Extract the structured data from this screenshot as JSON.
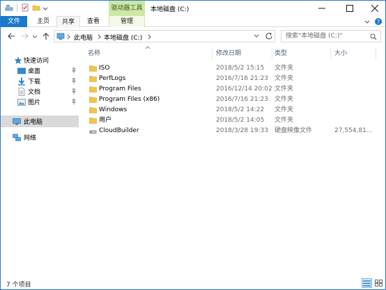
{
  "window": {
    "title": "本地磁盘 (C:)",
    "contextual_tab_title": "驱动器工具"
  },
  "ribbon": {
    "tabs": [
      "文件",
      "主页",
      "共享",
      "查看",
      "管理"
    ]
  },
  "address": {
    "breadcrumb": [
      "此电脑",
      "本地磁盘 (C:)"
    ],
    "search_placeholder": "搜索\"本地磁盘 (C:)\""
  },
  "nav": {
    "quick_access": "快速访问",
    "pinned": [
      "桌面",
      "下载",
      "文档",
      "图片"
    ],
    "this_pc": "此电脑",
    "network": "网络"
  },
  "columns": {
    "name": "名称",
    "date": "修改日期",
    "type": "类型",
    "size": "大小"
  },
  "files": [
    {
      "name": "ISO",
      "date": "2018/5/2 15:15",
      "type": "文件夹",
      "size": "",
      "icon": "folder-icon"
    },
    {
      "name": "PerfLogs",
      "date": "2016/7/16 21:23",
      "type": "文件夹",
      "size": "",
      "icon": "folder-icon"
    },
    {
      "name": "Program Files",
      "date": "2016/12/14 20:02",
      "type": "文件夹",
      "size": "",
      "icon": "folder-icon"
    },
    {
      "name": "Program Files (x86)",
      "date": "2016/7/16 21:23",
      "type": "文件夹",
      "size": "",
      "icon": "folder-icon"
    },
    {
      "name": "Windows",
      "date": "2018/5/2 14:22",
      "type": "文件夹",
      "size": "",
      "icon": "folder-icon"
    },
    {
      "name": "用户",
      "date": "2018/5/2 14:05",
      "type": "文件夹",
      "size": "",
      "icon": "folder-icon"
    },
    {
      "name": "CloudBuilder",
      "date": "2018/3/28 19:33",
      "type": "硬盘映像文件",
      "size": "27,554,81...",
      "icon": "disk-image-icon"
    }
  ],
  "status": {
    "item_count": "7 个项目"
  },
  "colors": {
    "accent": "#1979ca",
    "folder": "#f2c44f",
    "selected_nav": "#d9d9d9",
    "context_tab": "#cde8a4",
    "header_text": "#4c607a"
  }
}
